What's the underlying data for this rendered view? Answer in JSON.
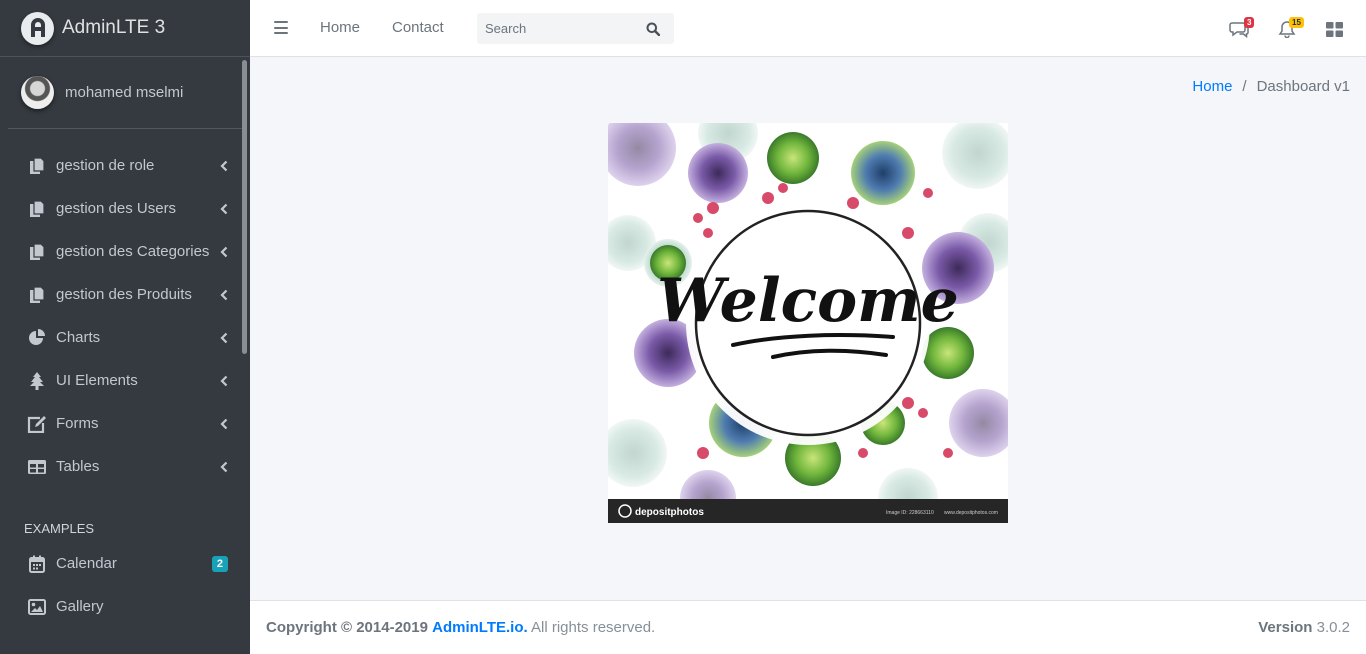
{
  "brand": {
    "name": "AdminLTE 3"
  },
  "user": {
    "name": "mohamed mselmi"
  },
  "sidebar": {
    "items": [
      {
        "label": "gestion de role",
        "icon": "copy-icon"
      },
      {
        "label": "gestion des Users",
        "icon": "copy-icon"
      },
      {
        "label": "gestion des Categories",
        "icon": "copy-icon"
      },
      {
        "label": "gestion des Produits",
        "icon": "copy-icon"
      },
      {
        "label": "Charts",
        "icon": "pie-chart-icon"
      },
      {
        "label": "UI Elements",
        "icon": "tree-icon"
      },
      {
        "label": "Forms",
        "icon": "edit-icon"
      },
      {
        "label": "Tables",
        "icon": "table-icon"
      }
    ],
    "header": "EXAMPLES",
    "examples": [
      {
        "label": "Calendar",
        "icon": "calendar-icon",
        "badge": "2"
      },
      {
        "label": "Gallery",
        "icon": "image-icon"
      }
    ]
  },
  "topnav": {
    "home": "Home",
    "contact": "Contact",
    "search_placeholder": "Search",
    "messages_count": "3",
    "notifications_count": "15"
  },
  "breadcrumb": {
    "home": "Home",
    "separator": "/",
    "current": "Dashboard v1"
  },
  "welcome_image": {
    "text": "Welcome",
    "watermark": "depositphotos",
    "image_id": "Image ID: 228663110",
    "site": "www.depositphotos.com"
  },
  "footer": {
    "copyright": "Copyright © 2014-2019",
    "brand_link": "AdminLTE.io.",
    "rights": "All rights reserved.",
    "version_label": "Version",
    "version": "3.0.2"
  },
  "colors": {
    "sidebar_bg": "#343a40",
    "accent": "#007bff",
    "badge_info": "#17a2b8",
    "badge_danger": "#dc3545",
    "badge_warning": "#ffc107"
  }
}
